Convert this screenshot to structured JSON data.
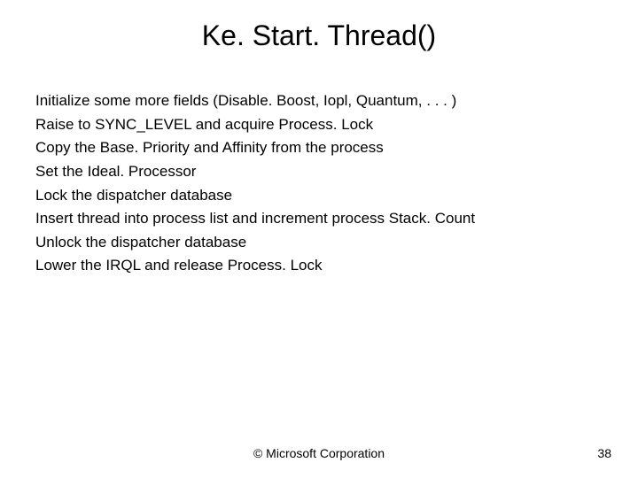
{
  "title": "Ke. Start. Thread()",
  "lines": [
    "Initialize some more fields (Disable. Boost, Iopl, Quantum, . . . )",
    "Raise to SYNC_LEVEL and acquire Process. Lock",
    "Copy the Base. Priority and Affinity from the process",
    "Set the Ideal. Processor",
    "Lock the dispatcher database",
    "Insert thread into process list and increment process Stack. Count",
    "Unlock the dispatcher database",
    "Lower the IRQL and release Process. Lock"
  ],
  "copyright": "© Microsoft Corporation",
  "page_number": "38"
}
